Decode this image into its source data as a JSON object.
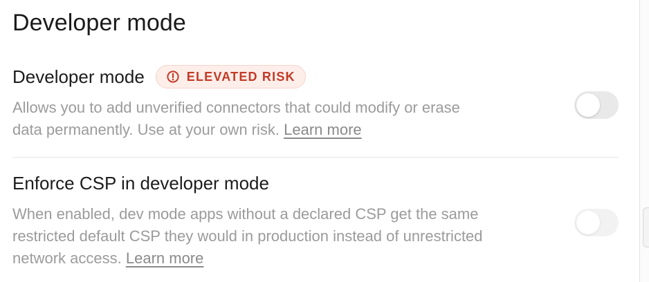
{
  "section": {
    "title": "Developer mode"
  },
  "developer_mode": {
    "title": "Developer mode",
    "badge": {
      "icon": "alert-circle-icon",
      "label": "ELEVATED RISK",
      "color": "#c23a26",
      "background": "#fdeeea"
    },
    "description": "Allows you to add unverified connectors that could modify or erase data permanently. Use at your own risk.",
    "learn_more": "Learn more",
    "enabled": false
  },
  "enforce_csp": {
    "title": "Enforce CSP in developer mode",
    "description": "When enabled, dev mode apps without a declared CSP get the same restricted default CSP they would in production instead of unrestricted network access.",
    "learn_more": "Learn more",
    "enabled": false,
    "disabled": true
  }
}
